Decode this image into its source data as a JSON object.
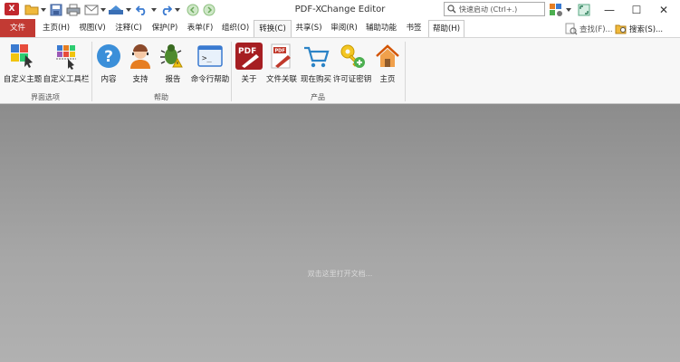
{
  "window": {
    "title": "PDF-XChange Editor",
    "app_logo_text": "X",
    "minimize": "—",
    "maximize": "☐",
    "close": "✕"
  },
  "search": {
    "placeholder": "快速启动 (Ctrl+.)"
  },
  "tabs": [
    "文件",
    "主页(H)",
    "视图(V)",
    "注释(C)",
    "保护(P)",
    "表单(F)",
    "组织(O)",
    "转换(C)",
    "共享(S)",
    "审阅(R)",
    "辅助功能",
    "书签",
    "帮助(H)"
  ],
  "active_tab": "帮助(H)",
  "ribbon_tools": {
    "find": "查找(F)...",
    "search": "搜索(S)..."
  },
  "ribbon": {
    "groups": [
      {
        "label": "界面选项",
        "buttons": [
          "自定义主题",
          "自定义工具栏"
        ]
      },
      {
        "label": "帮助",
        "buttons": [
          "内容",
          "支持",
          "报告",
          "命令行帮助"
        ]
      },
      {
        "label": "产品",
        "buttons": [
          "关于",
          "文件关联",
          "现在购买",
          "许可证密钥",
          "主页"
        ]
      }
    ]
  },
  "icon_text": {
    "pdf_label": "PDF",
    "pdf_small": "PDF",
    "help_mark": "?",
    "cmd_prompt": ">_"
  },
  "canvas": {
    "hint": "双击这里打开文档..."
  },
  "colors": {
    "file_tab": "#c23a33",
    "ribbon_bg": "#f7f7f7",
    "canvas_top": "#8c8c8c",
    "canvas_bottom": "#b1b1b1"
  }
}
